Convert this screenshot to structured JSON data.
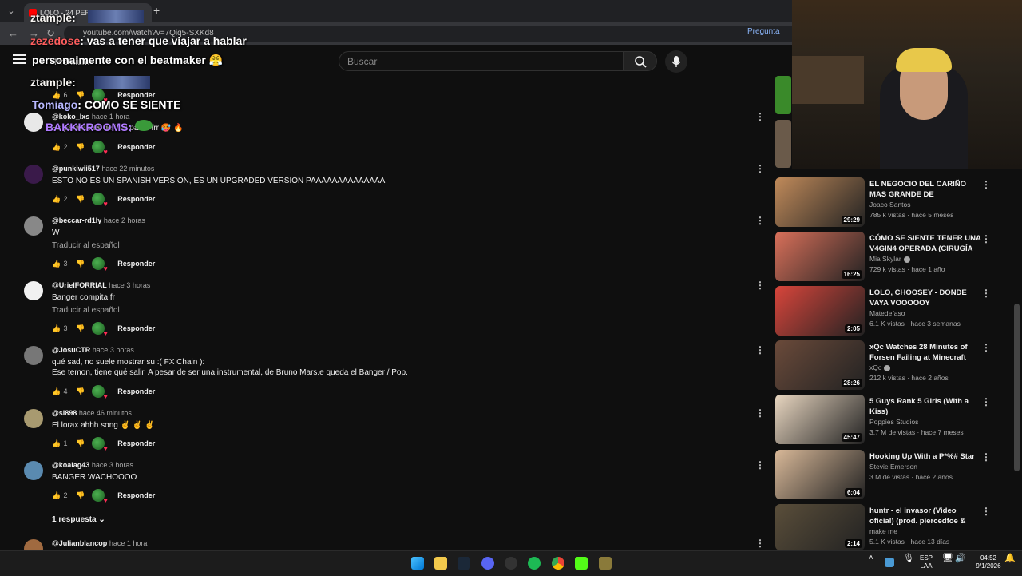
{
  "browser": {
    "tab_title": "LOLO - 24 PERRAS (SPANISH",
    "url": "youtube.com/watch?v=7Qiq5-SXKd8",
    "pregunta_label": "Pregunta"
  },
  "youtube": {
    "search_placeholder": "Buscar",
    "premium_label": "Premium"
  },
  "chat": [
    {
      "user": "ztample",
      "text": ""
    },
    {
      "user": "zezedose",
      "text": ": vas a tener que viajar a hablar"
    },
    {
      "user": "",
      "text": "personalmente con el beatmaker 😤"
    },
    {
      "user": "ztample",
      "text": ""
    },
    {
      "user": "Tomiago",
      "text": ": COMO SE SIENTE"
    },
    {
      "user": "BAKKKROOMS",
      "text": ""
    }
  ],
  "comments": [
    {
      "handle": "@koko_lxs",
      "time": "hace 1 hora",
      "lines": [
        "Es para antes de ir al padel frr 🥵 🔥"
      ],
      "likes": "2",
      "translate": "",
      "reply_label": "Responder"
    },
    {
      "handle": "@punkiwii517",
      "time": "hace 22 minutos",
      "lines": [
        "ESTO NO ES UN SPANISH VERSION, ES UN UPGRADED VERSION PAAAAAAAAAAAAAA"
      ],
      "likes": "2",
      "translate": "",
      "reply_label": "Responder"
    },
    {
      "handle": "@beccar-rd1ly",
      "time": "hace 2 horas",
      "lines": [
        "W"
      ],
      "likes": "3",
      "translate": "Traducir al español",
      "reply_label": "Responder"
    },
    {
      "handle": "@UrielFORRIAL",
      "time": "hace 3 horas",
      "lines": [
        "Banger compita fr"
      ],
      "likes": "3",
      "translate": "Traducir al español",
      "reply_label": "Responder"
    },
    {
      "handle": "@JosuCTR",
      "time": "hace 3 horas",
      "lines": [
        "qué sad, no suele mostrar su :( FX Chain ):",
        "Ese temon, tiene qué salir. A pesar de ser una instrumental, de Bruno Mars.e queda el Banger / Pop."
      ],
      "likes": "4",
      "translate": "",
      "reply_label": "Responder"
    },
    {
      "handle": "@si898",
      "time": "hace 46 minutos",
      "lines": [
        "El lorax ahhh song ✌ ✌ ✌"
      ],
      "likes": "1",
      "translate": "",
      "reply_label": "Responder"
    },
    {
      "handle": "@koalag43",
      "time": "hace 3 horas",
      "lines": [
        "BANGER WACHOOOO"
      ],
      "likes": "2",
      "translate": "",
      "reply_label": "Responder",
      "replies": "1 respuesta"
    },
    {
      "handle": "@Julianblancop",
      "time": "hace 1 hora",
      "lines": [],
      "likes": "",
      "translate": "",
      "reply_label": ""
    }
  ],
  "top_partial": {
    "likes": "6",
    "reply_label": "Responder"
  },
  "recommendations": [
    {
      "title": "EL NEGOCIO DEL CARIÑO MAS GRANDE DE LATINOAMERICA ...",
      "channel": "Joaco Santos",
      "stats": "785 k vistas · hace 5 meses",
      "duration": "29:29",
      "verified": false,
      "thumb_color": "#c08a5a"
    },
    {
      "title": "CÓMO SE SIENTE TENER UNA V4GIN4 OPERADA (CIRUGÍA D...",
      "channel": "Mia Skylar",
      "stats": "729 k vistas · hace 1 año",
      "duration": "16:25",
      "verified": true,
      "thumb_color": "#d9705a"
    },
    {
      "title": "LOLO, CHOOSEY - DONDE VAYA VOOOOOY",
      "channel": "Matedefaso",
      "stats": "6.1 K vistas · hace 3 semanas",
      "duration": "2:05",
      "verified": false,
      "thumb_color": "#d8453b"
    },
    {
      "title": "xQc Watches 28 Minutes of Forsen Failing at Minecraft",
      "channel": "xQc",
      "stats": "212 k vistas · hace 2 años",
      "duration": "28:26",
      "verified": true,
      "thumb_color": "#6a4a3a"
    },
    {
      "title": "5 Guys Rank 5 Girls (With a Kiss)",
      "channel": "Poppies Studios",
      "stats": "3.7 M de vistas · hace 7 meses",
      "duration": "45:47",
      "verified": false,
      "thumb_color": "#e8d6c0"
    },
    {
      "title": "Hooking Up With a P*%# Star",
      "channel": "Stevie Emerson",
      "stats": "3 M de vistas · hace 2 años",
      "duration": "6:04",
      "verified": false,
      "thumb_color": "#d8b898"
    },
    {
      "title": "huntr - el invasor (Video oficial) (prod. piercedfoe & huntr)",
      "channel": "make me",
      "stats": "5.1 K vistas · hace 13 días",
      "duration": "2:14",
      "verified": false,
      "thumb_color": "#5a4e3a"
    }
  ],
  "taskbar": {
    "lang_top": "ESP",
    "lang_bottom": "LAA",
    "time": "04:52",
    "date": "9/1/2026"
  }
}
